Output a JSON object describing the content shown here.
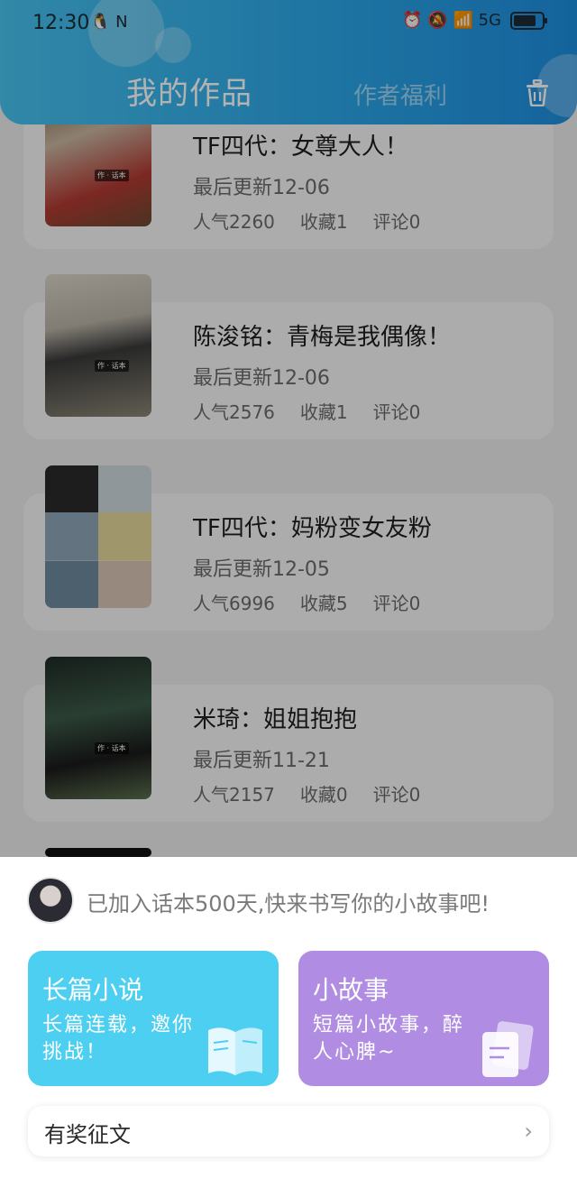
{
  "status_bar": {
    "time": "12:30",
    "app_icons": "🐧 N",
    "right_icons": "⏰ 🔕 📶 5G"
  },
  "header": {
    "tab_active": "我的作品",
    "tab_inactive": "作者福利"
  },
  "works": [
    {
      "title": "TF四代：女尊大人！",
      "updated": "最后更新12-06",
      "popularity": "人气2260",
      "favorites": "收藏1",
      "comments": "评论0",
      "cover_color": "#b23a32"
    },
    {
      "title": "陈浚铭：青梅是我偶像！",
      "updated": "最后更新12-06",
      "popularity": "人气2576",
      "favorites": "收藏1",
      "comments": "评论0",
      "cover_color": "#6e6c5e"
    },
    {
      "title": "TF四代：妈粉变女友粉",
      "updated": "最后更新12-05",
      "popularity": "人气6996",
      "favorites": "收藏5",
      "comments": "评论0",
      "cover_color": "#5a6f7a"
    },
    {
      "title": "米琦：姐姐抱抱",
      "updated": "最后更新11-21",
      "popularity": "人气2157",
      "favorites": "收藏0",
      "comments": "评论0",
      "cover_color": "#2f3b2c"
    }
  ],
  "sheet": {
    "join_text": "已加入话本500天,快来书写你的小故事吧!",
    "novel": {
      "title": "长篇小说",
      "desc": "长篇连载，邀你挑战！",
      "color": "#4ccff0"
    },
    "story": {
      "title": "小故事",
      "desc": "短篇小故事，醉人心脾~",
      "color": "#b08de3"
    },
    "contest": "有奖征文"
  }
}
